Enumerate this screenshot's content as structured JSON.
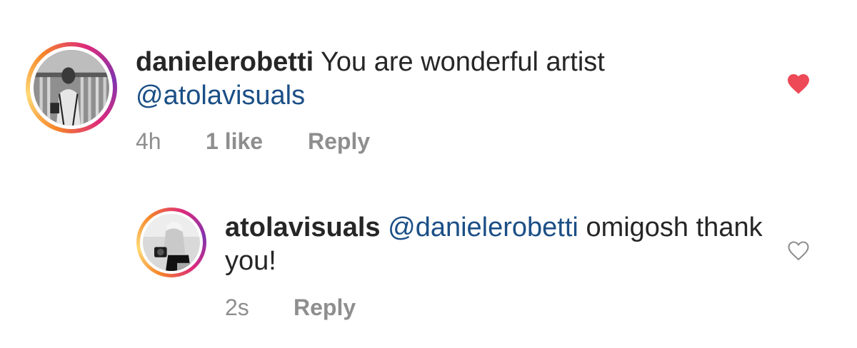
{
  "comments": [
    {
      "username": "danielerobetti",
      "text": "You are wonderful artist",
      "mention": "@atolavisuals",
      "time": "4h",
      "likes": "1 like",
      "reply_label": "Reply",
      "liked": true
    },
    {
      "username": "atolavisuals",
      "mention": "@danielerobetti",
      "text": "omigosh thank you!",
      "time": "2s",
      "reply_label": "Reply",
      "liked": false
    }
  ],
  "colors": {
    "mention": "#1b4f86",
    "meta": "#8e8e8e",
    "liked_heart": "#ed4956",
    "unliked_heart": "#8e8e8e"
  },
  "icons": {
    "liked": "heart-filled-icon",
    "unliked": "heart-outline-icon"
  }
}
